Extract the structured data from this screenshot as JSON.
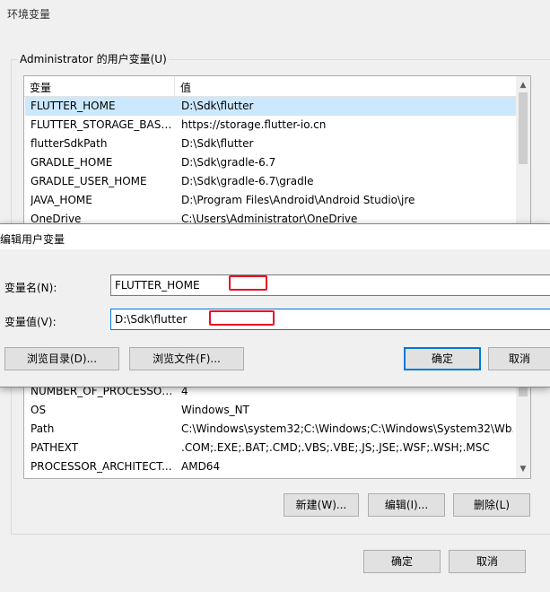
{
  "window": {
    "title": "环境变量"
  },
  "user_vars": {
    "group_label": "Administrator 的用户变量(U)",
    "columns": [
      "变量",
      "值"
    ],
    "rows": [
      {
        "name": "FLUTTER_HOME",
        "value": "D:\\Sdk\\flutter"
      },
      {
        "name": "FLUTTER_STORAGE_BASE_...",
        "value": "https://storage.flutter-io.cn"
      },
      {
        "name": "flutterSdkPath",
        "value": "D:\\Sdk\\flutter"
      },
      {
        "name": "GRADLE_HOME",
        "value": "D:\\Sdk\\gradle-6.7"
      },
      {
        "name": "GRADLE_USER_HOME",
        "value": "D:\\Sdk\\gradle-6.7\\gradle"
      },
      {
        "name": "JAVA_HOME",
        "value": "D:\\Program Files\\Android\\Android Studio\\jre"
      },
      {
        "name": "OneDrive",
        "value": "C:\\Users\\Administrator\\OneDrive"
      }
    ]
  },
  "system_vars": {
    "rows": [
      {
        "name": "NUMBER_OF_PROCESSORS",
        "value": "4"
      },
      {
        "name": "OS",
        "value": "Windows_NT"
      },
      {
        "name": "Path",
        "value": "C:\\Windows\\system32;C:\\Windows;C:\\Windows\\System32\\Wb..."
      },
      {
        "name": "PATHEXT",
        "value": ".COM;.EXE;.BAT;.CMD;.VBS;.VBE;.JS;.JSE;.WSF;.WSH;.MSC"
      },
      {
        "name": "PROCESSOR_ARCHITECT...",
        "value": "AMD64"
      }
    ],
    "buttons": {
      "new": "新建(W)...",
      "edit": "编辑(I)...",
      "delete": "删除(L)"
    }
  },
  "footer": {
    "ok": "确定",
    "cancel": "取消"
  },
  "dialog": {
    "title": "编辑用户变量",
    "name_label": "变量名(N):",
    "name_value": "FLUTTER_HOME",
    "value_label": "变量值(V):",
    "value_value": "D:\\Sdk\\flutter",
    "browse_dir": "浏览目录(D)...",
    "browse_file": "浏览文件(F)...",
    "ok": "确定",
    "cancel": "取消"
  },
  "colors": {
    "accent": "#0078d7",
    "selection": "#cce8ff",
    "highlight_mark": "#e81123"
  }
}
